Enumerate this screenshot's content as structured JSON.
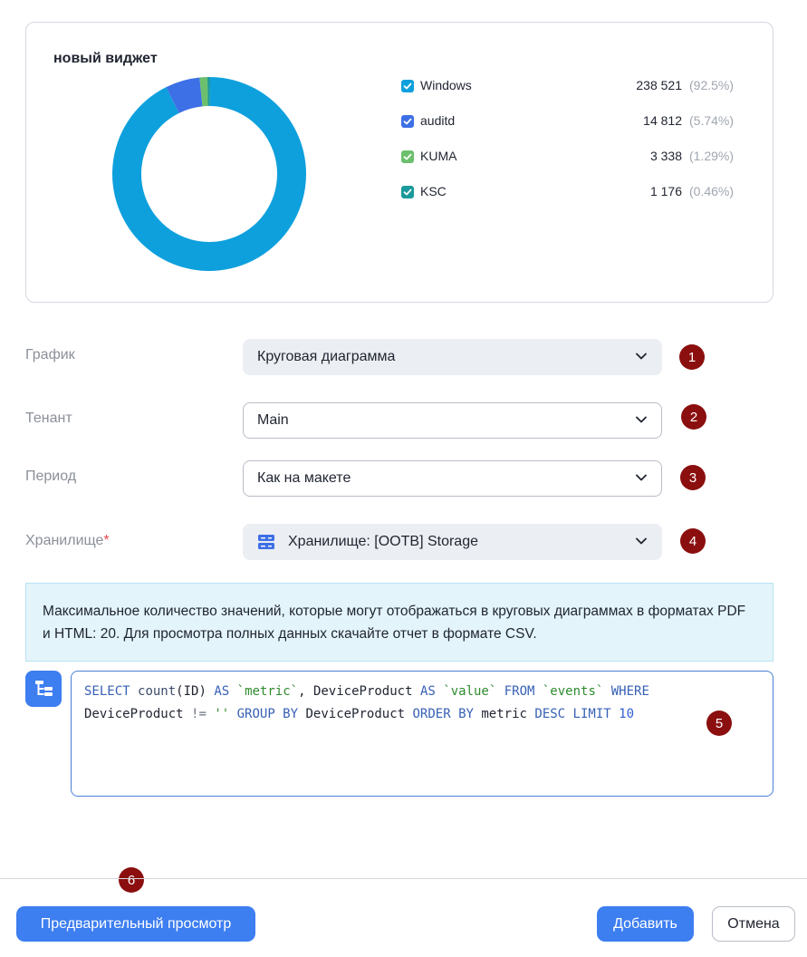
{
  "widget": {
    "title": "новый виджет",
    "legend": [
      {
        "name": "Windows",
        "value": "238 521",
        "percent": "(92.5%)",
        "color": "#0ea0dd"
      },
      {
        "name": "auditd",
        "value": "14 812",
        "percent": "(5.74%)",
        "color": "#3d6fe6"
      },
      {
        "name": "KUMA",
        "value": "3 338",
        "percent": "(1.29%)",
        "color": "#6cbf6c"
      },
      {
        "name": "KSC",
        "value": "1 176",
        "percent": "(0.46%)",
        "color": "#1a9a9a"
      }
    ]
  },
  "chart_data": {
    "type": "pie",
    "categories": [
      "Windows",
      "auditd",
      "KUMA",
      "KSC"
    ],
    "values": [
      238521,
      14812,
      3338,
      1176
    ],
    "title": "новый виджет"
  },
  "form": {
    "chart_label": "График",
    "chart_value": "Круговая диаграмма",
    "tenant_label": "Тенант",
    "tenant_value": "Main",
    "period_label": "Период",
    "period_value": "Как на макете",
    "storage_label": "Хранилище",
    "storage_required": "*",
    "storage_value": "Хранилище: [OOTB] Storage"
  },
  "badges": [
    "1",
    "2",
    "3",
    "4",
    "5",
    "6"
  ],
  "info": {
    "text": "Максимальное количество значений, которые могут отображаться в круговых диаграммах в форматах PDF и HTML: 20. Для просмотра полных данных скачайте отчет в формате CSV."
  },
  "query": {
    "tokens": {
      "select": "SELECT",
      "count": "count",
      "open": "(",
      "id": "ID",
      "close": ")",
      "as1": "AS",
      "metric": "`metric`",
      "comma": ",",
      "device1": "DeviceProduct",
      "as2": "AS",
      "value": "`value`",
      "from": "FROM",
      "events": "`events`",
      "where": "WHERE",
      "device2": "DeviceProduct",
      "neq": "!=",
      "empty": "''",
      "groupby": "GROUP BY",
      "device3": "DeviceProduct",
      "orderby": "ORDER BY",
      "metric2": "metric",
      "desc": "DESC",
      "limit": "LIMIT",
      "ten": "10"
    }
  },
  "footer": {
    "preview": "Предварительный просмотр",
    "add": "Добавить",
    "cancel": "Отмена"
  }
}
